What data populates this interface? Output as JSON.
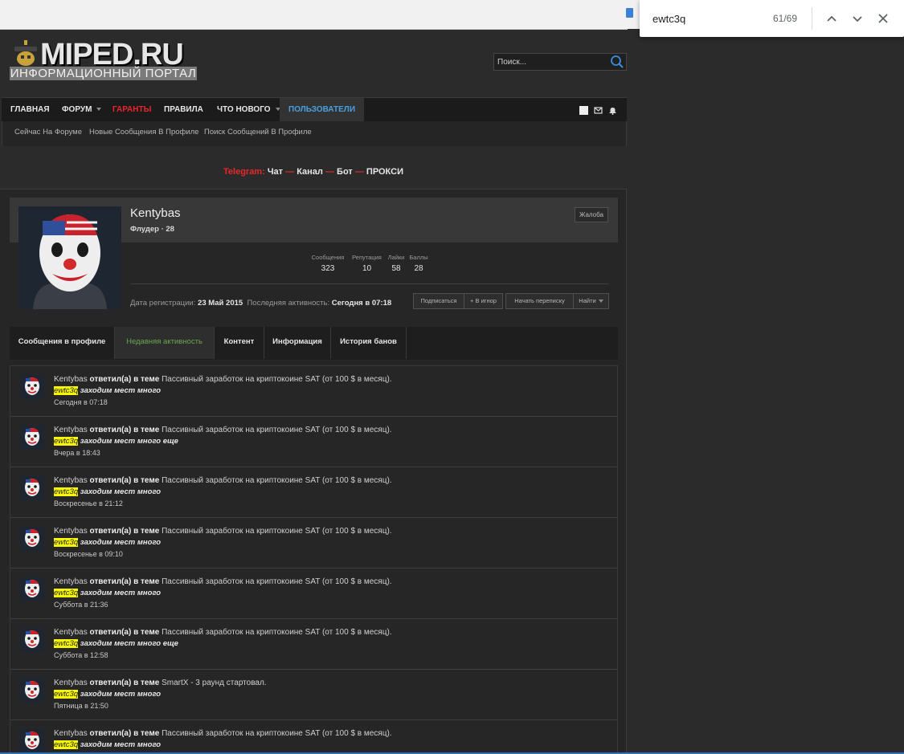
{
  "find": {
    "query": "ewtc3q",
    "count": "61/69"
  },
  "logo": {
    "title": "MIPED.RU",
    "subtitle": "ИНФОРМАЦИОННЫЙ ПОРТАЛ"
  },
  "search": {
    "placeholder": "Поиск..."
  },
  "nav": {
    "items": [
      "ГЛАВНАЯ",
      "ФОРУМ",
      "ГАРАНТЫ",
      "ПРАВИЛА",
      "ЧТО НОВОГО",
      "ПОЛЬЗОВАТЕЛИ"
    ],
    "sub": [
      "Сейчас На Форуме",
      "Новые Сообщения В Профиле",
      "Поиск Сообщений В Профиле"
    ]
  },
  "telegram": {
    "label": "Telegram:",
    "chat": "Чат",
    "dash": "—",
    "channel": "Канал",
    "bot": "Бот",
    "proxy": "ПРОКСИ"
  },
  "profile": {
    "username": "Kentybas",
    "usertitle": "Флудер · 28",
    "report": "Жалоба",
    "stats": [
      {
        "label": "Сообщения",
        "value": "323"
      },
      {
        "label": "Репутация",
        "value": "10"
      },
      {
        "label": "Лайки",
        "value": "58"
      },
      {
        "label": "Баллы",
        "value": "28"
      }
    ],
    "reg_label": "Дата регистрации:",
    "reg_value": "23 Май 2015",
    "last_label": "Последняя активность:",
    "last_value": "Сегодня в 07:18",
    "actions": [
      "Подписаться",
      "+ В игнор",
      "Начать переписку",
      "Найти"
    ]
  },
  "tabs": [
    "Сообщения в профиле",
    "Недавняя активность",
    "Контент",
    "Информация",
    "История банов"
  ],
  "activity": {
    "verb": "ответил(а) в теме",
    "items": [
      {
        "user": "Kentybas",
        "thread": "Пассивный заработок на криптокоине SAT (от 100 $ в месяц).",
        "hl": "ewtc3q",
        "snippet": " заходим мест много",
        "time": "Сегодня в 07:18"
      },
      {
        "user": "Kentybas",
        "thread": "Пассивный заработок на криптокоине SAT (от 100 $ в месяц).",
        "hl": "ewtc3q",
        "snippet": " заходим мест много еще",
        "time": "Вчера в 18:43"
      },
      {
        "user": "Kentybas",
        "thread": "Пассивный заработок на криптокоине SAT (от 100 $ в месяц).",
        "hl": "ewtc3q",
        "snippet": " заходим мест много",
        "time": "Воскресенье в 21:12"
      },
      {
        "user": "Kentybas",
        "thread": "Пассивный заработок на криптокоине SAT (от 100 $ в месяц).",
        "hl": "ewtc3q",
        "snippet": " заходим мест много",
        "time": "Воскресенье в 09:10"
      },
      {
        "user": "Kentybas",
        "thread": "Пассивный заработок на криптокоине SAT (от 100 $ в месяц).",
        "hl": "ewtc3q",
        "snippet": " заходим мест много",
        "time": "Суббота в 21:36"
      },
      {
        "user": "Kentybas",
        "thread": "Пассивный заработок на криптокоине SAT (от 100 $ в месяц).",
        "hl": "ewtc3q",
        "snippet": " заходим мест много еще",
        "time": "Суббота в 12:58"
      },
      {
        "user": "Kentybas",
        "thread": "SmartX - 3 раунд стартовал.",
        "hl": "ewtc3q",
        "snippet": " заходим мест много",
        "time": "Пятница в 21:50"
      },
      {
        "user": "Kentybas",
        "thread": "Пассивный заработок на криптокоине SAT (от 100 $ в месяц).",
        "hl": "ewtc3q",
        "snippet": " заходим мест много",
        "time": ""
      }
    ]
  }
}
